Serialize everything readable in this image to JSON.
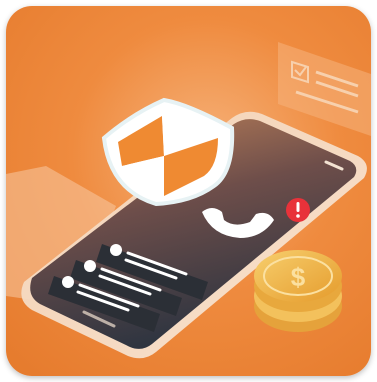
{
  "illustration": {
    "icons": [
      "shield-icon",
      "phone-call-icon",
      "alert-icon",
      "coin-stack-icon",
      "dollar-icon",
      "document-check-icon"
    ],
    "colors": {
      "background": "#e9812f",
      "phone_screen_top": "#b9784f",
      "phone_screen_bottom": "#2f3742",
      "notification": "#2b2f36",
      "alert": "#e8323a",
      "coin": "#f0b44a",
      "shield_orange": "#ef8a32"
    },
    "notifications": [
      "notification-1",
      "notification-2",
      "notification-3"
    ]
  }
}
